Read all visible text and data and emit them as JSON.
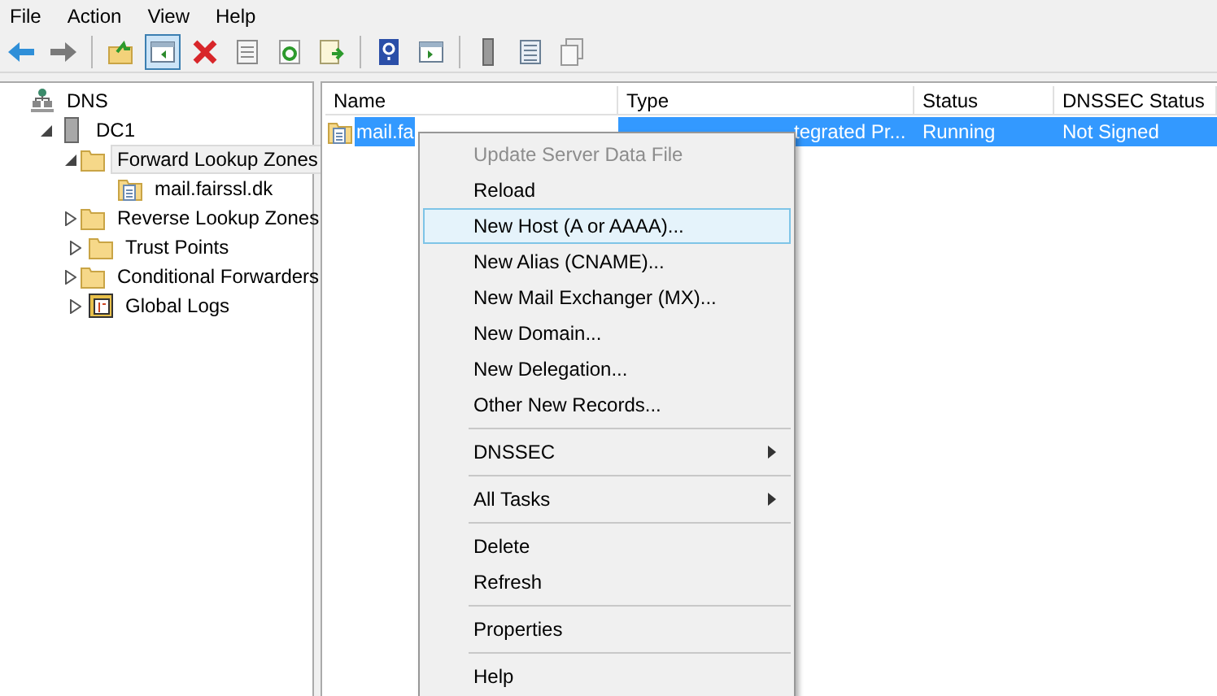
{
  "menu_bar": [
    "File",
    "Action",
    "View",
    "Help"
  ],
  "toolbar": [
    {
      "buttons": [
        {
          "kind": "back",
          "pressed": false
        },
        {
          "kind": "forward",
          "pressed": false
        }
      ]
    },
    {
      "buttons": [
        {
          "kind": "up",
          "pressed": false
        },
        {
          "kind": "tree",
          "pressed": true
        },
        {
          "kind": "delete",
          "pressed": false
        },
        {
          "kind": "properties",
          "pressed": false
        },
        {
          "kind": "refresh",
          "pressed": false
        },
        {
          "kind": "export",
          "pressed": false
        }
      ]
    },
    {
      "buttons": [
        {
          "kind": "help",
          "pressed": false
        },
        {
          "kind": "pane",
          "pressed": false
        }
      ]
    },
    {
      "buttons": [
        {
          "kind": "server",
          "pressed": false
        },
        {
          "kind": "list",
          "pressed": false
        },
        {
          "kind": "copy",
          "pressed": false
        }
      ]
    }
  ],
  "tree": [
    {
      "label": "DNS",
      "kind": "dns",
      "selected": false,
      "children": [
        {
          "label": "DC1",
          "kind": "server",
          "expanded": true,
          "selected": false,
          "children": [
            {
              "label": "Forward Lookup Zones",
              "kind": "folder",
              "expanded": true,
              "selected": true,
              "children": [
                {
                  "label": "mail.fairssl.dk",
                  "kind": "zone",
                  "selected": false
                }
              ]
            },
            {
              "label": "Reverse Lookup Zones",
              "kind": "folder",
              "expanded": false,
              "selected": false
            },
            {
              "label": "Trust Points",
              "kind": "folder",
              "expanded": false,
              "selected": false
            },
            {
              "label": "Conditional Forwarders",
              "kind": "folder",
              "expanded": false,
              "selected": false
            },
            {
              "label": "Global Logs",
              "kind": "logs",
              "expanded": false,
              "selected": false
            }
          ]
        }
      ]
    }
  ],
  "table": {
    "columns": [
      "Name",
      "Type",
      "Status",
      "DNSSEC Status"
    ],
    "rows": [
      {
        "selected": true,
        "cells": [
          "mail.fa",
          "tegrated Pr...",
          "Running",
          "Not Signed"
        ]
      }
    ]
  },
  "context_menu": [
    {
      "kind": "item",
      "label": "Update Server Data File",
      "disabled": true,
      "selected": false,
      "submenu": false
    },
    {
      "kind": "item",
      "label": "Reload",
      "disabled": false,
      "selected": false,
      "submenu": false
    },
    {
      "kind": "item",
      "label": "New Host (A or AAAA)...",
      "disabled": false,
      "selected": true,
      "submenu": false
    },
    {
      "kind": "item",
      "label": "New Alias (CNAME)...",
      "disabled": false,
      "selected": false,
      "submenu": false
    },
    {
      "kind": "item",
      "label": "New Mail Exchanger (MX)...",
      "disabled": false,
      "selected": false,
      "submenu": false
    },
    {
      "kind": "item",
      "label": "New Domain...",
      "disabled": false,
      "selected": false,
      "submenu": false
    },
    {
      "kind": "item",
      "label": "New Delegation...",
      "disabled": false,
      "selected": false,
      "submenu": false
    },
    {
      "kind": "item",
      "label": "Other New Records...",
      "disabled": false,
      "selected": false,
      "submenu": false
    },
    {
      "kind": "separator"
    },
    {
      "kind": "item",
      "label": "DNSSEC",
      "disabled": false,
      "selected": false,
      "submenu": true
    },
    {
      "kind": "separator"
    },
    {
      "kind": "item",
      "label": "All Tasks",
      "disabled": false,
      "selected": false,
      "submenu": true
    },
    {
      "kind": "separator"
    },
    {
      "kind": "item",
      "label": "Delete",
      "disabled": false,
      "selected": false,
      "submenu": false
    },
    {
      "kind": "item",
      "label": "Refresh",
      "disabled": false,
      "selected": false,
      "submenu": false
    },
    {
      "kind": "separator"
    },
    {
      "kind": "item",
      "label": "Properties",
      "disabled": false,
      "selected": false,
      "submenu": false
    },
    {
      "kind": "separator"
    },
    {
      "kind": "item",
      "label": "Help",
      "disabled": false,
      "selected": false,
      "submenu": false
    }
  ]
}
